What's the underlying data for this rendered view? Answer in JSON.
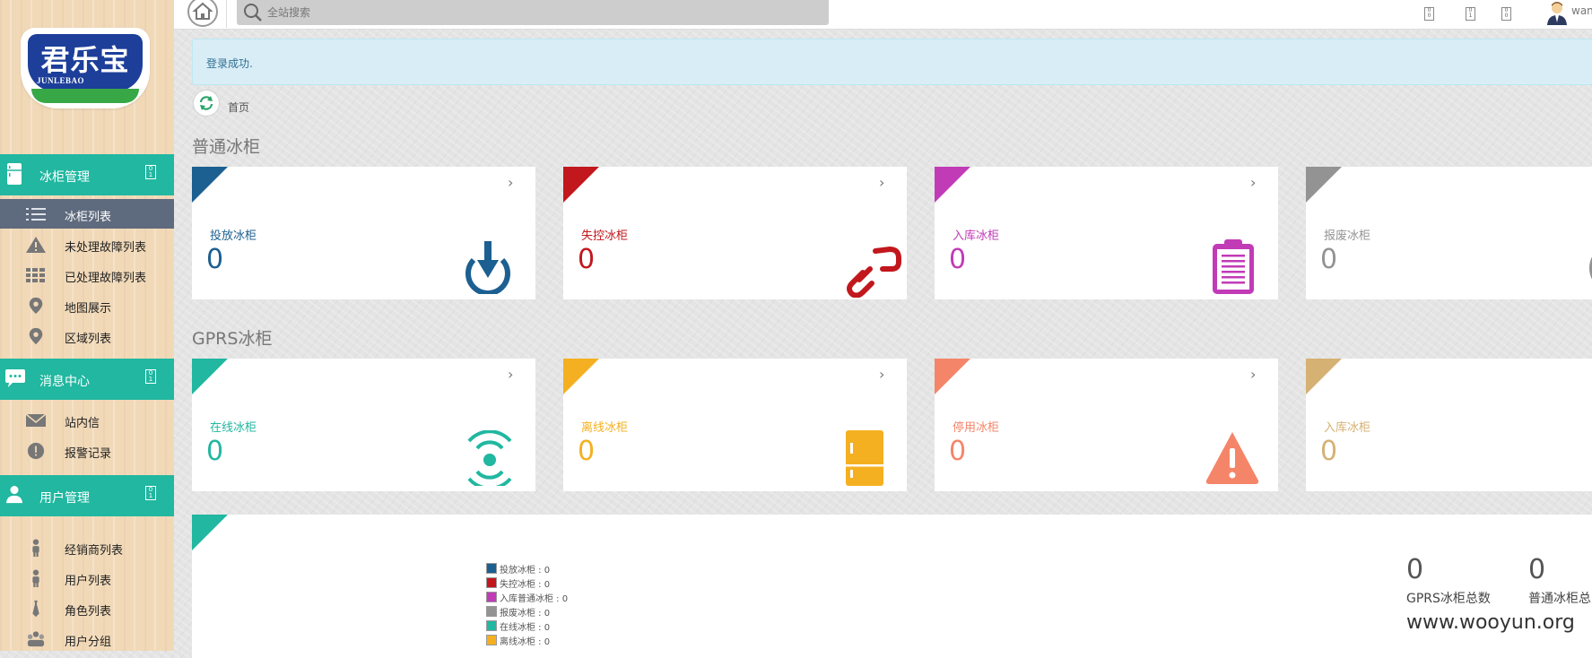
{
  "brand": {
    "name_cn": "君乐宝",
    "name_en": "JUNLEBAO"
  },
  "search": {
    "placeholder": "全站搜索"
  },
  "header": {
    "user_name": "wan"
  },
  "alert": {
    "text": "登录成功."
  },
  "breadcrumb": {
    "home": "首页"
  },
  "sidebar": {
    "sections": [
      {
        "label": "冰柜管理",
        "icon": "fridge-icon",
        "items": [
          {
            "label": "冰柜列表",
            "icon": "list-icon",
            "active": true
          },
          {
            "label": "未处理故障列表",
            "icon": "warning-icon"
          },
          {
            "label": "已处理故障列表",
            "icon": "grid-icon"
          },
          {
            "label": "地图展示",
            "icon": "map-pin-icon"
          },
          {
            "label": "区域列表",
            "icon": "map-pin-icon"
          }
        ]
      },
      {
        "label": "消息中心",
        "icon": "chat-icon",
        "items": [
          {
            "label": "站内信",
            "icon": "envelope-icon"
          },
          {
            "label": "报警记录",
            "icon": "alert-circle-icon"
          }
        ]
      },
      {
        "label": "用户管理",
        "icon": "user-icon",
        "items": [
          {
            "label": "经销商列表",
            "icon": "person-icon"
          },
          {
            "label": "用户列表",
            "icon": "person-icon"
          },
          {
            "label": "角色列表",
            "icon": "tie-icon"
          },
          {
            "label": "用户分组",
            "icon": "group-icon"
          }
        ]
      }
    ]
  },
  "groups": {
    "normal": {
      "title": "普通冰柜",
      "cards": [
        {
          "label": "投放冰柜",
          "value": "0",
          "color": "#1c5f91",
          "icon": "download-arrow-icon"
        },
        {
          "label": "失控冰柜",
          "value": "0",
          "color": "#c1171d",
          "icon": "broken-link-icon"
        },
        {
          "label": "入库冰柜",
          "value": "0",
          "color": "#c13bb7",
          "icon": "clipboard-icon"
        },
        {
          "label": "报废冰柜",
          "value": "0",
          "color": "#939393",
          "icon": "circle-icon"
        }
      ]
    },
    "gprs": {
      "title": "GPRS冰柜",
      "cards": [
        {
          "label": "在线冰柜",
          "value": "0",
          "color": "#21b7a0",
          "icon": "signal-icon"
        },
        {
          "label": "离线冰柜",
          "value": "0",
          "color": "#f5b021",
          "icon": "fridge-icon"
        },
        {
          "label": "停用冰柜",
          "value": "0",
          "color": "#f58569",
          "icon": "warning-triangle-icon"
        },
        {
          "label": "入库冰柜",
          "value": "0",
          "color": "#d5b174",
          "icon": "clipboard-icon"
        }
      ]
    }
  },
  "legend": [
    {
      "label": "投放冰柜 : 0",
      "color": "#1c5f91"
    },
    {
      "label": "失控冰柜 : 0",
      "color": "#c1171d"
    },
    {
      "label": "入库普通冰柜 : 0",
      "color": "#c13bb7"
    },
    {
      "label": "报废冰柜 : 0",
      "color": "#939393"
    },
    {
      "label": "在线冰柜 : 0",
      "color": "#21b7a0"
    },
    {
      "label": "离线冰柜 : 0",
      "color": "#f5b021"
    }
  ],
  "stats": [
    {
      "value": "0",
      "label": "GPRS冰柜总数"
    },
    {
      "value": "0",
      "label": "普通冰柜总"
    }
  ],
  "watermark": "www.wooyun.org"
}
